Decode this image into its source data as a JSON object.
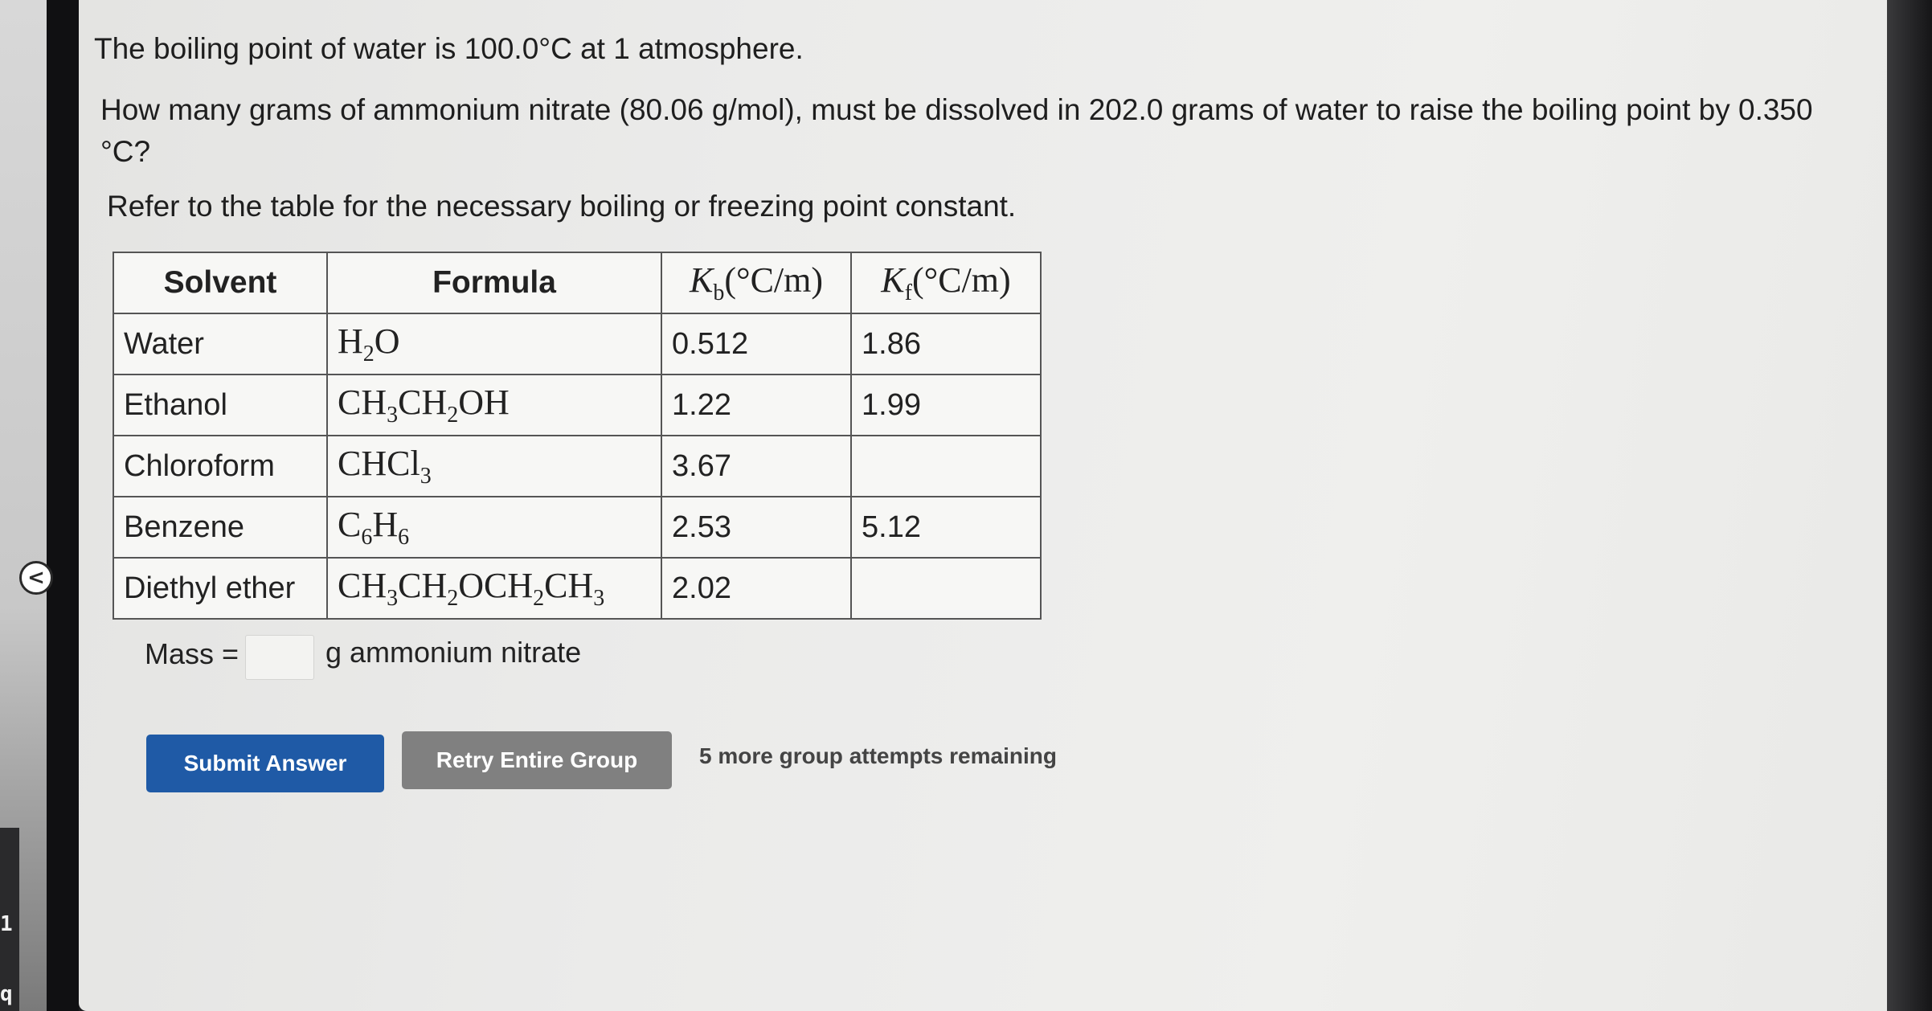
{
  "question": {
    "line1": "The boiling point of water is 100.0°C at 1 atmosphere.",
    "line2": "How many grams of ammonium nitrate (80.06 g/mol), must be dissolved in 202.0 grams of water to raise the boiling point by 0.350 °C?",
    "line3": "Refer to the table for the necessary boiling or freezing point constant."
  },
  "table": {
    "headers": {
      "solvent": "Solvent",
      "formula": "Formula",
      "kb": "Kb(°C/m)",
      "kf": "Kf(°C/m)"
    },
    "rows": [
      {
        "solvent": "Water",
        "formula": "H2O",
        "kb": "0.512",
        "kf": "1.86"
      },
      {
        "solvent": "Ethanol",
        "formula": "CH3CH2OH",
        "kb": "1.22",
        "kf": "1.99"
      },
      {
        "solvent": "Chloroform",
        "formula": "CHCl3",
        "kb": "3.67",
        "kf": ""
      },
      {
        "solvent": "Benzene",
        "formula": "C6H6",
        "kb": "2.53",
        "kf": "5.12"
      },
      {
        "solvent": "Diethyl ether",
        "formula": "CH3CH2OCH2CH3",
        "kb": "2.02",
        "kf": ""
      }
    ]
  },
  "answer": {
    "label": "Mass =",
    "value": "",
    "unit": "g ammonium nitrate"
  },
  "buttons": {
    "submit": "Submit Answer",
    "retry": "Retry Entire Group"
  },
  "attempts_text": "5 more group attempts remaining",
  "sidebar": {
    "collapse_glyph": "<",
    "edge_glyph_1": "1",
    "edge_glyph_2": "q"
  },
  "colors": {
    "submit_bg": "#1f5aa6",
    "retry_bg": "#808080"
  }
}
